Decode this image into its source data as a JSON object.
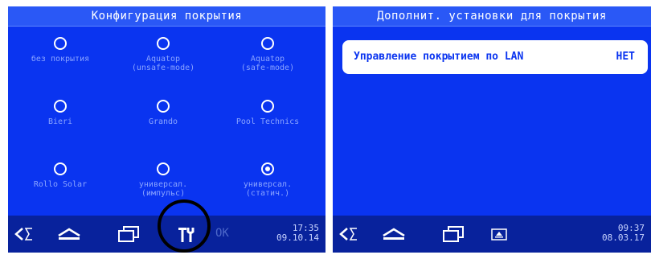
{
  "left_screen": {
    "title": "Конфигурация покрытия",
    "options": [
      {
        "label": "без покрытия",
        "selected": false
      },
      {
        "label": "Aquatop\n(unsafe-mode)",
        "selected": false
      },
      {
        "label": "Aquatop\n(safe-mode)",
        "selected": false
      },
      {
        "label": "Bieri",
        "selected": false
      },
      {
        "label": "Grando",
        "selected": false
      },
      {
        "label": "Pool Technics",
        "selected": false
      },
      {
        "label": "Rollo Solar",
        "selected": false
      },
      {
        "label": "универсал.\n(импульс)",
        "selected": false
      },
      {
        "label": "универсал.\n(статич.)",
        "selected": true
      }
    ],
    "bottom_bar": {
      "ok_label": "OK",
      "time": "17:35",
      "date": "09.10.14"
    }
  },
  "right_screen": {
    "title": "Дополнит. установки для покрытия",
    "lan_setting": {
      "label": "Управление покрытием по LAN",
      "value": "НЕТ"
    },
    "bottom_bar": {
      "time": "09:37",
      "date": "08.03.17"
    }
  },
  "icons": {
    "back": "back-arrow-icon",
    "home": "home-icon",
    "windows": "windows-icon",
    "settings": "tools-icon",
    "eject": "eject-icon"
  },
  "colors": {
    "screen_bg": "#0a34f0",
    "title_bar": "#2a58f6",
    "bottom_bar": "#08229c",
    "option_label": "#8aa4ff",
    "annotation": "#000000"
  }
}
